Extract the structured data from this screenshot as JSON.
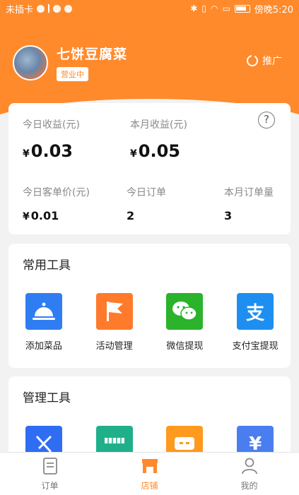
{
  "status_bar": {
    "carrier": "未插卡",
    "time": "傍晚5:20"
  },
  "shop": {
    "name": "七饼豆腐菜",
    "status": "营业中",
    "promote_label": "推广"
  },
  "stats": {
    "today_income_label": "今日收益(元)",
    "today_income": "0.03",
    "month_income_label": "本月收益(元)",
    "month_income": "0.05",
    "avg_price_label": "今日客单价(元)",
    "avg_price": "0.01",
    "today_orders_label": "今日订单",
    "today_orders": "2",
    "month_orders_label": "本月订单量",
    "month_orders": "3",
    "currency": "¥",
    "help": "?"
  },
  "common_tools": {
    "title": "常用工具",
    "items": [
      {
        "label": "添加菜品",
        "icon": "cloche-icon",
        "color": "#2f7df2"
      },
      {
        "label": "活动管理",
        "icon": "flag-icon",
        "color": "#ff7a2b"
      },
      {
        "label": "微信提现",
        "icon": "wechat-icon",
        "color": "#2bb32b"
      },
      {
        "label": "支付宝提现",
        "icon": "alipay-icon",
        "color": "#1e8ff0",
        "glyph": "支"
      }
    ]
  },
  "manage_tools": {
    "title": "管理工具",
    "items": [
      {
        "icon": "cutlery-icon",
        "color": "#2f6df2"
      },
      {
        "icon": "storefront-icon",
        "color": "#1fb08a"
      },
      {
        "icon": "chat-icon",
        "color": "#ff9a1e"
      },
      {
        "icon": "receipt-icon",
        "color": "#4a7ef0",
        "glyph": "¥"
      }
    ]
  },
  "tabbar": {
    "items": [
      {
        "label": "订单",
        "icon": "order-icon",
        "active": false
      },
      {
        "label": "店铺",
        "icon": "shop-icon",
        "active": true
      },
      {
        "label": "我的",
        "icon": "user-icon",
        "active": false
      }
    ]
  },
  "colors": {
    "accent": "#ff8a2b"
  }
}
